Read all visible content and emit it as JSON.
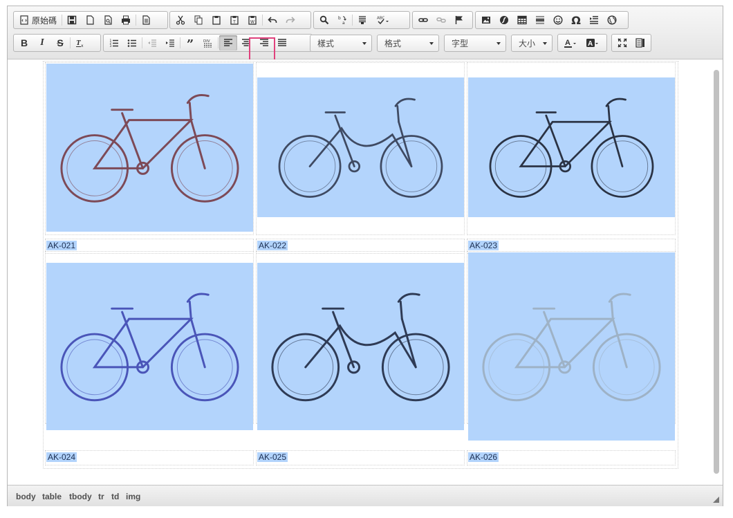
{
  "toolbar": {
    "source_label": "原始碼",
    "style_combo": "樣式",
    "format_combo": "格式",
    "font_combo": "字型",
    "size_combo": "大小"
  },
  "items": [
    {
      "code": "AK-021",
      "color": "#7d4a57"
    },
    {
      "code": "AK-022",
      "color": "#3f4a62"
    },
    {
      "code": "AK-023",
      "color": "#2b3344"
    },
    {
      "code": "AK-024",
      "color": "#4a55b8"
    },
    {
      "code": "AK-025",
      "color": "#2f3b55"
    },
    {
      "code": "AK-026",
      "color": "#9eb2c6"
    }
  ],
  "statusbar": {
    "path": [
      "body",
      "table",
      "tbody",
      "tr",
      "td",
      "img"
    ]
  },
  "colors": {
    "selection": "#b3d4fc",
    "highlight_border": "#e0417c"
  }
}
